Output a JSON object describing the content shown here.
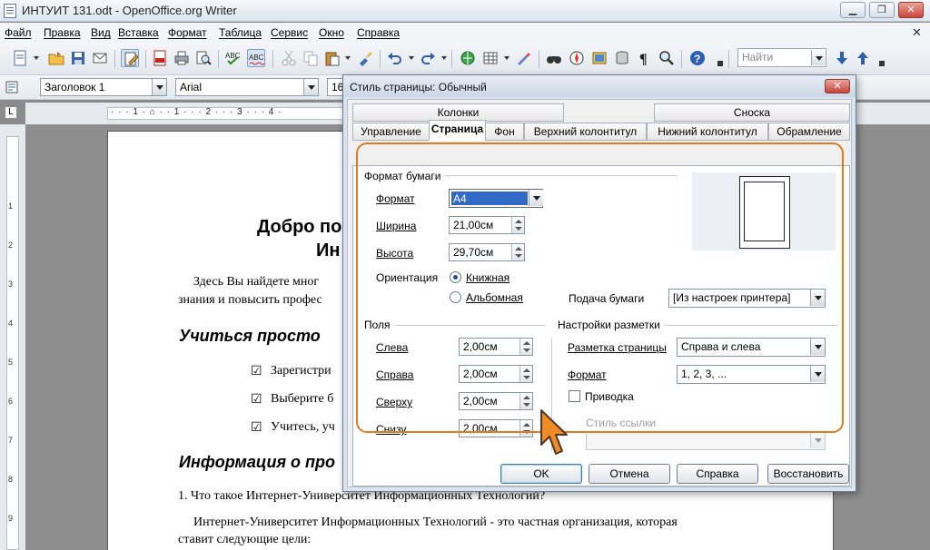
{
  "window": {
    "title": "ИНТУИТ 131.odt - OpenOffice.org Writer",
    "minimize": "▁",
    "maximize": "❐",
    "close": "✕"
  },
  "menu": [
    "Файл",
    "Правка",
    "Вид",
    "Вставка",
    "Формат",
    "Таблица",
    "Сервис",
    "Окно",
    "Справка"
  ],
  "toolbar": {
    "find_placeholder": "Найти"
  },
  "format_bar": {
    "style": "Заголовок 1",
    "font": "Arial",
    "size": "16"
  },
  "ruler": {
    "numbers": "· · · 1 · ⌂ · · 1 · · · 2 · · · 3 · · · 4 ·",
    "vertical": [
      "1",
      "2",
      "3",
      "4",
      "5",
      "6",
      "7",
      "8",
      "9"
    ]
  },
  "document": {
    "heading1_line1": "Добро по",
    "heading1_line2": "Ин",
    "intro_line1": "Здесь Вы найдете мног",
    "intro_line2": "знания и повысить профес",
    "heading2": "Учиться просто",
    "checklist": [
      "Зарегистри",
      "Выберите б",
      "Учитесь, уч"
    ],
    "heading3": "Информация о про",
    "q1": "1.  Что такое Интернет-Университет Информационных Технологий?",
    "p1_line1": "Интернет-Университет  Информационных  Технологий  -  это  частная  организация,  которая",
    "p1_line2": "ставит следующие цели:"
  },
  "dialog": {
    "title": "Стиль страницы: Обычный",
    "close": "✕",
    "tabs_top": [
      "Колонки",
      "Сноска"
    ],
    "tabs": [
      "Управление",
      "Страница",
      "Фон",
      "Верхний колонтитул",
      "Нижний колонтитул",
      "Обрамление"
    ],
    "selected_tab": "Страница",
    "paper_format": {
      "group": "Формат бумаги",
      "format_label": "Формат",
      "format_value": "A4",
      "width_label": "Ширина",
      "width_value": "21,00см",
      "height_label": "Высота",
      "height_value": "29,70см",
      "orientation_label": "Ориентация",
      "portrait": "Книжная",
      "landscape": "Альбомная",
      "paper_tray_label": "Подача бумаги",
      "paper_tray_value": "[Из настроек принтера]"
    },
    "margins": {
      "group": "Поля",
      "left_label": "Слева",
      "left_value": "2,00см",
      "right_label": "Справа",
      "right_value": "2,00см",
      "top_label": "Сверху",
      "top_value": "2,00см",
      "bottom_label": "Снизу",
      "bottom_value": "2,00см"
    },
    "layout": {
      "group": "Настройки разметки",
      "page_layout_label": "Разметка страницы",
      "page_layout_value": "Справа и слева",
      "format_label": "Формат",
      "format_value": "1, 2, 3, ...",
      "register_label": "Приводка",
      "ref_style_label": "Стиль ссылки",
      "ref_style_value": ""
    },
    "buttons": {
      "ok": "OK",
      "cancel": "Отмена",
      "help": "Справка",
      "reset": "Восстановить"
    }
  },
  "colors": {
    "highlight": "#e07b1f",
    "cursor": "#f08a24"
  }
}
